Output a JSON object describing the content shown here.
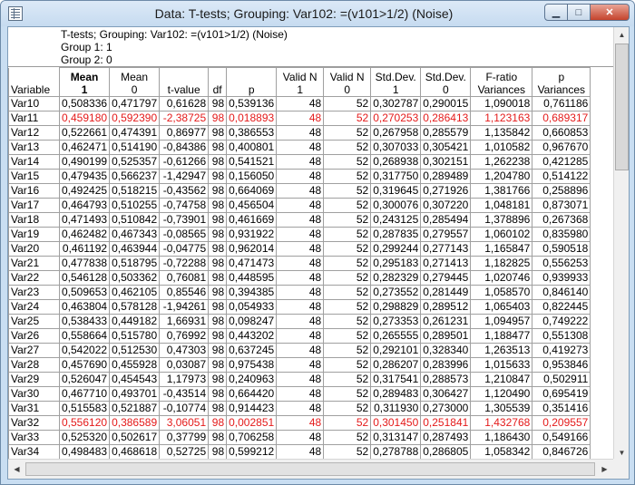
{
  "window": {
    "title": "Data: T-tests; Grouping: Var102: =(v101>1/2) (Noise)",
    "min_glyph": "▁",
    "max_glyph": "□",
    "close_glyph": "✕"
  },
  "info": {
    "line1": "T-tests; Grouping: Var102: =(v101>1/2) (Noise)",
    "line2": "Group 1: 1",
    "line3": "Group 2: 0"
  },
  "columns": {
    "variable": "Variable",
    "c1": [
      "Mean",
      "1"
    ],
    "c2": [
      "Mean",
      "0"
    ],
    "c3": [
      "t-value",
      ""
    ],
    "c4": [
      "df",
      ""
    ],
    "c5": [
      "p",
      ""
    ],
    "c6": [
      "Valid N",
      "1"
    ],
    "c7": [
      "Valid N",
      "0"
    ],
    "c8": [
      "Std.Dev.",
      "1"
    ],
    "c9": [
      "Std.Dev.",
      "0"
    ],
    "c10": [
      "F-ratio",
      "Variances"
    ],
    "c11": [
      "p",
      "Variances"
    ]
  },
  "highlight_color": "#e41a1a",
  "rows": [
    {
      "name": "Var10",
      "v": [
        "0,508336",
        "0,471797",
        "0,61628",
        "98",
        "0,539136",
        "48",
        "52",
        "0,302787",
        "0,290015",
        "1,090018",
        "0,761186"
      ],
      "hl": false
    },
    {
      "name": "Var11",
      "v": [
        "0,459180",
        "0,592390",
        "-2,38725",
        "98",
        "0,018893",
        "48",
        "52",
        "0,270253",
        "0,286413",
        "1,123163",
        "0,689317"
      ],
      "hl": true
    },
    {
      "name": "Var12",
      "v": [
        "0,522661",
        "0,474391",
        "0,86977",
        "98",
        "0,386553",
        "48",
        "52",
        "0,267958",
        "0,285579",
        "1,135842",
        "0,660853"
      ],
      "hl": false
    },
    {
      "name": "Var13",
      "v": [
        "0,462471",
        "0,514190",
        "-0,84386",
        "98",
        "0,400801",
        "48",
        "52",
        "0,307033",
        "0,305421",
        "1,010582",
        "0,967670"
      ],
      "hl": false
    },
    {
      "name": "Var14",
      "v": [
        "0,490199",
        "0,525357",
        "-0,61266",
        "98",
        "0,541521",
        "48",
        "52",
        "0,268938",
        "0,302151",
        "1,262238",
        "0,421285"
      ],
      "hl": false
    },
    {
      "name": "Var15",
      "v": [
        "0,479435",
        "0,566237",
        "-1,42947",
        "98",
        "0,156050",
        "48",
        "52",
        "0,317750",
        "0,289489",
        "1,204780",
        "0,514122"
      ],
      "hl": false
    },
    {
      "name": "Var16",
      "v": [
        "0,492425",
        "0,518215",
        "-0,43562",
        "98",
        "0,664069",
        "48",
        "52",
        "0,319645",
        "0,271926",
        "1,381766",
        "0,258896"
      ],
      "hl": false
    },
    {
      "name": "Var17",
      "v": [
        "0,464793",
        "0,510255",
        "-0,74758",
        "98",
        "0,456504",
        "48",
        "52",
        "0,300076",
        "0,307220",
        "1,048181",
        "0,873071"
      ],
      "hl": false
    },
    {
      "name": "Var18",
      "v": [
        "0,471493",
        "0,510842",
        "-0,73901",
        "98",
        "0,461669",
        "48",
        "52",
        "0,243125",
        "0,285494",
        "1,378896",
        "0,267368"
      ],
      "hl": false
    },
    {
      "name": "Var19",
      "v": [
        "0,462482",
        "0,467343",
        "-0,08565",
        "98",
        "0,931922",
        "48",
        "52",
        "0,287835",
        "0,279557",
        "1,060102",
        "0,835980"
      ],
      "hl": false
    },
    {
      "name": "Var20",
      "v": [
        "0,461192",
        "0,463944",
        "-0,04775",
        "98",
        "0,962014",
        "48",
        "52",
        "0,299244",
        "0,277143",
        "1,165847",
        "0,590518"
      ],
      "hl": false
    },
    {
      "name": "Var21",
      "v": [
        "0,477838",
        "0,518795",
        "-0,72288",
        "98",
        "0,471473",
        "48",
        "52",
        "0,295183",
        "0,271413",
        "1,182825",
        "0,556253"
      ],
      "hl": false
    },
    {
      "name": "Var22",
      "v": [
        "0,546128",
        "0,503362",
        "0,76081",
        "98",
        "0,448595",
        "48",
        "52",
        "0,282329",
        "0,279445",
        "1,020746",
        "0,939933"
      ],
      "hl": false
    },
    {
      "name": "Var23",
      "v": [
        "0,509653",
        "0,462105",
        "0,85546",
        "98",
        "0,394385",
        "48",
        "52",
        "0,273552",
        "0,281449",
        "1,058570",
        "0,846140"
      ],
      "hl": false
    },
    {
      "name": "Var24",
      "v": [
        "0,463804",
        "0,578128",
        "-1,94261",
        "98",
        "0,054933",
        "48",
        "52",
        "0,298829",
        "0,289512",
        "1,065403",
        "0,822445"
      ],
      "hl": false
    },
    {
      "name": "Var25",
      "v": [
        "0,538433",
        "0,449182",
        "1,66931",
        "98",
        "0,098247",
        "48",
        "52",
        "0,273353",
        "0,261231",
        "1,094957",
        "0,749222"
      ],
      "hl": false
    },
    {
      "name": "Var26",
      "v": [
        "0,558664",
        "0,515780",
        "0,76992",
        "98",
        "0,443202",
        "48",
        "52",
        "0,265555",
        "0,289501",
        "1,188477",
        "0,551308"
      ],
      "hl": false
    },
    {
      "name": "Var27",
      "v": [
        "0,542022",
        "0,512530",
        "0,47303",
        "98",
        "0,637245",
        "48",
        "52",
        "0,292101",
        "0,328340",
        "1,263513",
        "0,419273"
      ],
      "hl": false
    },
    {
      "name": "Var28",
      "v": [
        "0,457690",
        "0,455928",
        "0,03087",
        "98",
        "0,975438",
        "48",
        "52",
        "0,286207",
        "0,283996",
        "1,015633",
        "0,953846"
      ],
      "hl": false
    },
    {
      "name": "Var29",
      "v": [
        "0,526047",
        "0,454543",
        "1,17973",
        "98",
        "0,240963",
        "48",
        "52",
        "0,317541",
        "0,288573",
        "1,210847",
        "0,502911"
      ],
      "hl": false
    },
    {
      "name": "Var30",
      "v": [
        "0,467710",
        "0,493701",
        "-0,43514",
        "98",
        "0,664420",
        "48",
        "52",
        "0,289483",
        "0,306427",
        "1,120490",
        "0,695419"
      ],
      "hl": false
    },
    {
      "name": "Var31",
      "v": [
        "0,515583",
        "0,521887",
        "-0,10774",
        "98",
        "0,914423",
        "48",
        "52",
        "0,311930",
        "0,273000",
        "1,305539",
        "0,351416"
      ],
      "hl": false
    },
    {
      "name": "Var32",
      "v": [
        "0,556120",
        "0,386589",
        "3,06051",
        "98",
        "0,002851",
        "48",
        "52",
        "0,301450",
        "0,251841",
        "1,432768",
        "0,209557"
      ],
      "hl": true
    },
    {
      "name": "Var33",
      "v": [
        "0,525320",
        "0,502617",
        "0,37799",
        "98",
        "0,706258",
        "48",
        "52",
        "0,313147",
        "0,287493",
        "1,186430",
        "0,549166"
      ],
      "hl": false
    },
    {
      "name": "Var34",
      "v": [
        "0,498483",
        "0,468618",
        "0,52725",
        "98",
        "0,599212",
        "48",
        "52",
        "0,278788",
        "0,286805",
        "1,058342",
        "0,846726"
      ],
      "hl": false
    }
  ]
}
